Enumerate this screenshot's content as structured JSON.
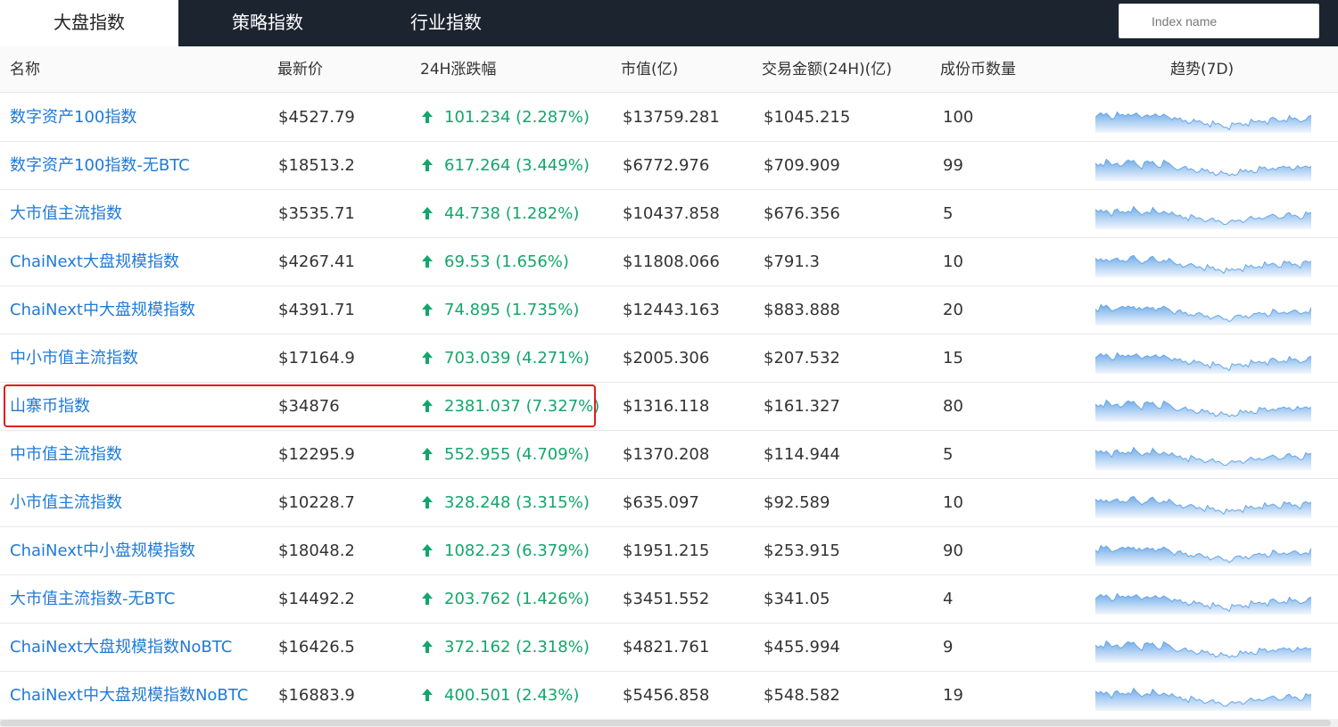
{
  "tabs": [
    {
      "label": "大盘指数",
      "active": true
    },
    {
      "label": "策略指数",
      "active": false
    },
    {
      "label": "行业指数",
      "active": false
    }
  ],
  "search": {
    "placeholder": "Index name"
  },
  "columns": [
    "名称",
    "最新价",
    "24H涨跌幅",
    "市值(亿)",
    "交易金额(24H)(亿)",
    "成份币数量",
    "趋势(7D)"
  ],
  "colors": {
    "link": "#1f7ad8",
    "up": "#13a66c",
    "topbar": "#1c2430",
    "highlight": "#e41c1c",
    "spark_line": "#6aa6e8"
  },
  "rows": [
    {
      "name": "数字资产100指数",
      "price": "$4527.79",
      "change": "101.234 (2.287%)",
      "direction": "up",
      "market_cap": "$13759.281",
      "volume": "$1045.215",
      "constituents": "100",
      "trend_icon": "sparkline-area-chart"
    },
    {
      "name": "数字资产100指数-无BTC",
      "price": "$18513.2",
      "change": "617.264 (3.449%)",
      "direction": "up",
      "market_cap": "$6772.976",
      "volume": "$709.909",
      "constituents": "99",
      "trend_icon": "sparkline-area-chart"
    },
    {
      "name": "大市值主流指数",
      "price": "$3535.71",
      "change": "44.738 (1.282%)",
      "direction": "up",
      "market_cap": "$10437.858",
      "volume": "$676.356",
      "constituents": "5",
      "trend_icon": "sparkline-area-chart"
    },
    {
      "name": "ChaiNext大盘规模指数",
      "price": "$4267.41",
      "change": "69.53 (1.656%)",
      "direction": "up",
      "market_cap": "$11808.066",
      "volume": "$791.3",
      "constituents": "10",
      "trend_icon": "sparkline-area-chart"
    },
    {
      "name": "ChaiNext中大盘规模指数",
      "price": "$4391.71",
      "change": "74.895 (1.735%)",
      "direction": "up",
      "market_cap": "$12443.163",
      "volume": "$883.888",
      "constituents": "20",
      "trend_icon": "sparkline-area-chart"
    },
    {
      "name": "中小市值主流指数",
      "price": "$17164.9",
      "change": "703.039 (4.271%)",
      "direction": "up",
      "market_cap": "$2005.306",
      "volume": "$207.532",
      "constituents": "15",
      "trend_icon": "sparkline-area-chart"
    },
    {
      "name": "山寨币指数",
      "price": "$34876",
      "change": "2381.037 (7.327%)",
      "direction": "up",
      "market_cap": "$1316.118",
      "volume": "$161.327",
      "constituents": "80",
      "trend_icon": "sparkline-area-chart",
      "highlighted": true
    },
    {
      "name": "中市值主流指数",
      "price": "$12295.9",
      "change": "552.955 (4.709%)",
      "direction": "up",
      "market_cap": "$1370.208",
      "volume": "$114.944",
      "constituents": "5",
      "trend_icon": "sparkline-area-chart"
    },
    {
      "name": "小市值主流指数",
      "price": "$10228.7",
      "change": "328.248 (3.315%)",
      "direction": "up",
      "market_cap": "$635.097",
      "volume": "$92.589",
      "constituents": "10",
      "trend_icon": "sparkline-area-chart"
    },
    {
      "name": "ChaiNext中小盘规模指数",
      "price": "$18048.2",
      "change": "1082.23 (6.379%)",
      "direction": "up",
      "market_cap": "$1951.215",
      "volume": "$253.915",
      "constituents": "90",
      "trend_icon": "sparkline-area-chart"
    },
    {
      "name": "大市值主流指数-无BTC",
      "price": "$14492.2",
      "change": "203.762 (1.426%)",
      "direction": "up",
      "market_cap": "$3451.552",
      "volume": "$341.05",
      "constituents": "4",
      "trend_icon": "sparkline-area-chart"
    },
    {
      "name": "ChaiNext大盘规模指数NoBTC",
      "price": "$16426.5",
      "change": "372.162 (2.318%)",
      "direction": "up",
      "market_cap": "$4821.761",
      "volume": "$455.994",
      "constituents": "9",
      "trend_icon": "sparkline-area-chart"
    },
    {
      "name": "ChaiNext中大盘规模指数NoBTC",
      "price": "$16883.9",
      "change": "400.501 (2.43%)",
      "direction": "up",
      "market_cap": "$5456.858",
      "volume": "$548.582",
      "constituents": "19",
      "trend_icon": "sparkline-area-chart"
    }
  ]
}
